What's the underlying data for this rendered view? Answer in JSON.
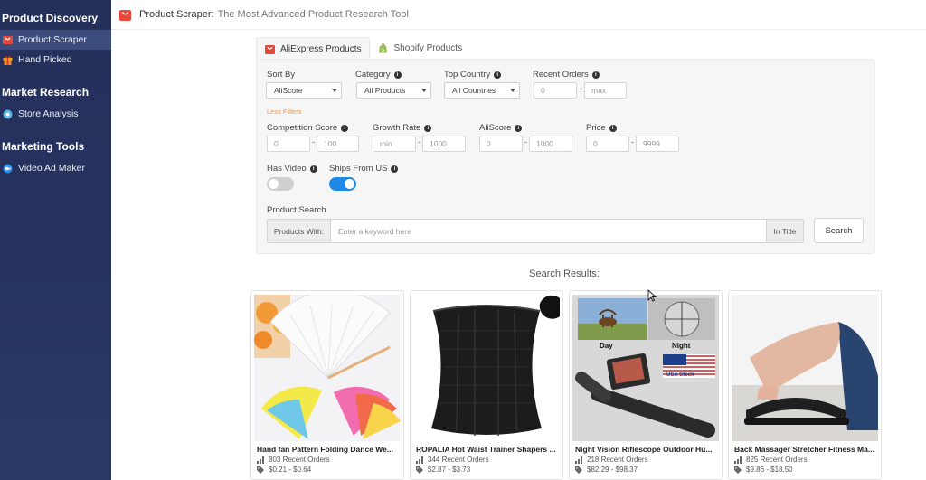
{
  "sidebar": {
    "sections": [
      {
        "title": "Product Discovery",
        "items": [
          {
            "label": "Product Scraper",
            "icon": "aliexpress-icon",
            "active": true
          },
          {
            "label": "Hand Picked",
            "icon": "gift-icon",
            "active": false
          }
        ]
      },
      {
        "title": "Market Research",
        "items": [
          {
            "label": "Store Analysis",
            "icon": "analysis-icon",
            "active": false
          }
        ]
      },
      {
        "title": "Marketing Tools",
        "items": [
          {
            "label": "Video Ad Maker",
            "icon": "video-icon",
            "active": false
          }
        ]
      }
    ]
  },
  "topbar": {
    "title": "Product Scraper:",
    "subtitle": "The Most Advanced Product Research Tool"
  },
  "tabs": [
    {
      "label": "AliExpress Products",
      "icon": "aliexpress-icon",
      "active": true
    },
    {
      "label": "Shopify Products",
      "icon": "shopify-icon",
      "active": false
    }
  ],
  "filters": {
    "sort_by": {
      "label": "Sort By",
      "value": "AliScore"
    },
    "category": {
      "label": "Category",
      "value": "All Products"
    },
    "top_country": {
      "label": "Top Country",
      "value": "All Countries"
    },
    "recent_orders": {
      "label": "Recent Orders",
      "min": "0",
      "max": "max"
    },
    "less_filters": "Less Filters",
    "competition_score": {
      "label": "Competition Score",
      "min": "0",
      "max": "100"
    },
    "growth_rate": {
      "label": "Growth Rate",
      "min": "min",
      "max": "1000"
    },
    "aliscore": {
      "label": "AliScore",
      "min": "0",
      "max": "1000"
    },
    "price": {
      "label": "Price",
      "min": "0",
      "max": "9999"
    },
    "has_video": {
      "label": "Has Video",
      "on": false
    },
    "ships_from_us": {
      "label": "Ships From US",
      "on": true
    },
    "dash": "-"
  },
  "product_search": {
    "label": "Product Search",
    "prefix": "Products With:",
    "placeholder": "Enter a keyword here",
    "suffix": "In Title",
    "button": "Search"
  },
  "results": {
    "title": "Search Results:",
    "products": [
      {
        "name": "Hand fan Pattern Folding Dance We...",
        "orders": "803 Recent Orders",
        "price": "$0.21 - $0.64"
      },
      {
        "name": "ROPALIA Hot Waist Trainer Shapers ...",
        "orders": "344 Recent Orders",
        "price": "$2.87 - $3.73"
      },
      {
        "name": "Night Vision Riflescope Outdoor Hu...",
        "orders": "218 Recent Orders",
        "price": "$82.29 - $98.37",
        "image_text": {
          "day": "Day",
          "night": "Night",
          "usa_stock": "USA Stock"
        }
      },
      {
        "name": "Back Massager Stretcher Fitness Ma...",
        "orders": "825 Recent Orders",
        "price": "$9.86 - $18.50"
      }
    ]
  },
  "colors": {
    "sidebar": "#26335f",
    "accent_blue": "#1e88e5",
    "aliexpress_red": "#e8483a",
    "less_filters": "#e8964a",
    "shopify_green": "#95bf47"
  }
}
